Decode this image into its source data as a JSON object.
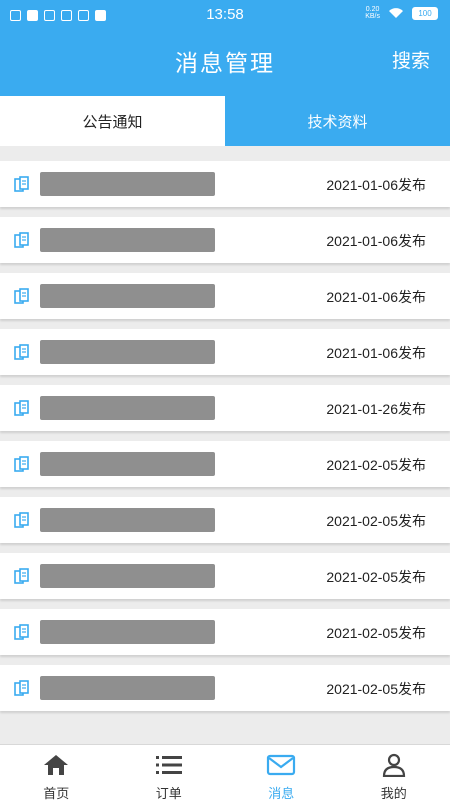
{
  "status_bar": {
    "time": "13:58",
    "speed_value": "0.20",
    "speed_unit": "KB/s",
    "battery": "100"
  },
  "header": {
    "title": "消息管理",
    "search_label": "搜索"
  },
  "tabs": [
    {
      "label": "公告通知",
      "active": false
    },
    {
      "label": "技术资料",
      "active": true
    }
  ],
  "list": {
    "items": [
      {
        "date": "2021-01-06",
        "suffix": "发布"
      },
      {
        "date": "2021-01-06",
        "suffix": "发布"
      },
      {
        "date": "2021-01-06",
        "suffix": "发布"
      },
      {
        "date": "2021-01-06",
        "suffix": "发布"
      },
      {
        "date": "2021-01-26",
        "suffix": "发布"
      },
      {
        "date": "2021-02-05",
        "suffix": "发布"
      },
      {
        "date": "2021-02-05",
        "suffix": "发布"
      },
      {
        "date": "2021-02-05",
        "suffix": "发布"
      },
      {
        "date": "2021-02-05",
        "suffix": "发布"
      },
      {
        "date": "2021-02-05",
        "suffix": "发布"
      }
    ]
  },
  "bottom_nav": [
    {
      "label": "首页",
      "icon": "home-icon",
      "active": false
    },
    {
      "label": "订单",
      "icon": "list-icon",
      "active": false
    },
    {
      "label": "消息",
      "icon": "mail-icon",
      "active": true
    },
    {
      "label": "我的",
      "icon": "user-icon",
      "active": false
    }
  ],
  "colors": {
    "primary": "#3aabf0",
    "redacted": "#8f8f8f"
  }
}
